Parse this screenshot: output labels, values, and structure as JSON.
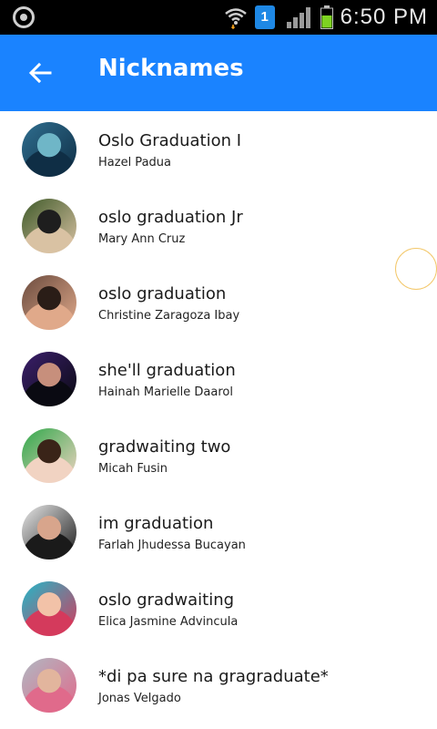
{
  "status_bar": {
    "time": "6:50 PM",
    "sim_label": "1",
    "icons": [
      "notification-icon",
      "wifi-icon",
      "sim-icon",
      "signal-icon",
      "battery-icon"
    ]
  },
  "app_bar": {
    "title": "Nicknames",
    "back_icon": "arrow-left-icon",
    "color": "#1a83ff"
  },
  "contacts": [
    {
      "nickname": "Oslo Graduation I",
      "name": "Hazel Padua",
      "avatar_colors": [
        "#2f6e8f",
        "#0f2e45",
        "#6fb6c7"
      ]
    },
    {
      "nickname": "oslo graduation Jr",
      "name": "Mary Ann Cruz",
      "avatar_colors": [
        "#3f5a2a",
        "#d9c2a3",
        "#1e1e1e"
      ]
    },
    {
      "nickname": "oslo graduation",
      "name": "Christine Zaragoza Ibay",
      "avatar_colors": [
        "#6b4b3e",
        "#e0a98a",
        "#2a1d17"
      ]
    },
    {
      "nickname": "she'll graduation",
      "name": "Hainah Marielle Daarol",
      "avatar_colors": [
        "#3b1f6b",
        "#0a0a12",
        "#c78f7c"
      ]
    },
    {
      "nickname": "gradwaiting two",
      "name": "Micah Fusin",
      "avatar_colors": [
        "#2fa84a",
        "#f1d3c2",
        "#3a2418"
      ]
    },
    {
      "nickname": "im graduation",
      "name": "Farlah Jhudessa Bucayan",
      "avatar_colors": [
        "#e9e9e9",
        "#1a1a1a",
        "#d8a58c"
      ]
    },
    {
      "nickname": "oslo gradwaiting",
      "name": "Elica Jasmine Advincula",
      "avatar_colors": [
        "#22b8c9",
        "#d43a5c",
        "#f2c2a8"
      ]
    },
    {
      "nickname": "*di pa sure na gragraduate*",
      "name": "Jonas Velgado",
      "avatar_colors": [
        "#b0b8c2",
        "#e06a8b",
        "#e2b59d"
      ]
    }
  ]
}
